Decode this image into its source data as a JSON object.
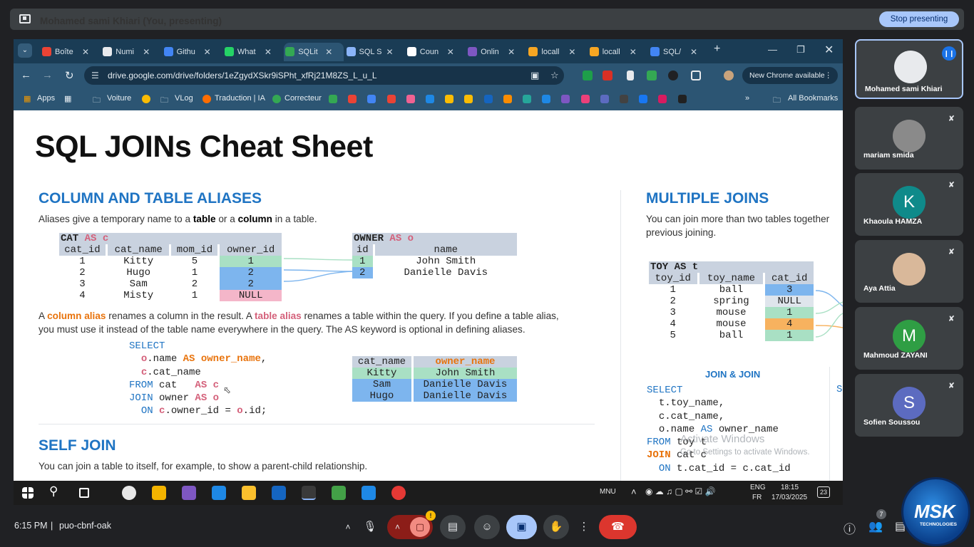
{
  "presenting_bar": {
    "text": "Mohamed sami Khiari (You, presenting)",
    "stop_label": "Stop presenting"
  },
  "browser": {
    "tabs": [
      {
        "label": "Boîte",
        "color": "#ea4335"
      },
      {
        "label": "Numi",
        "color": "#e8eaed"
      },
      {
        "label": "Githu",
        "color": "#4285f4"
      },
      {
        "label": "What",
        "color": "#25d366"
      },
      {
        "label": "SQLit",
        "color": "#34a853"
      },
      {
        "label": "SQL S",
        "color": "#8ab4f8"
      },
      {
        "label": "Coun",
        "color": "#ffffff"
      },
      {
        "label": "Onlin",
        "color": "#7e57c2"
      },
      {
        "label": "locall",
        "color": "#f6a623"
      },
      {
        "label": "locall",
        "color": "#f6a623"
      },
      {
        "label": "SQL/",
        "color": "#4285f4"
      }
    ],
    "url": "drive.google.com/drive/folders/1eZgydXSkr9iSPht_xfRj21M8ZS_L_u_L",
    "new_chrome": "New Chrome available",
    "bookmarks": {
      "apps": "Apps",
      "voiture": "Voiture",
      "vlog": "VLog",
      "traduction": "Traduction | IA",
      "correcteur": "Correcteur",
      "all": "All Bookmarks"
    }
  },
  "doc": {
    "title": "SQL JOINs Cheat Sheet",
    "aliases": {
      "heading": "COLUMN AND TABLE ALIASES",
      "intro": {
        "a": "Aliases give a temporary name to a ",
        "table": "table",
        "b": " or a ",
        "column": "column",
        "c": " in a table."
      },
      "cat_table": {
        "title": "CAT",
        "alias_kw": "AS c",
        "headers": [
          "cat_id",
          "cat_name",
          "mom_id",
          "owner_id"
        ],
        "rows": [
          [
            "1",
            "Kitty",
            "5",
            "1"
          ],
          [
            "2",
            "Hugo",
            "1",
            "2"
          ],
          [
            "3",
            "Sam",
            "2",
            "2"
          ],
          [
            "4",
            "Misty",
            "1",
            "NULL"
          ]
        ]
      },
      "owner_table": {
        "title": "OWNER",
        "alias_kw": "AS o",
        "headers": [
          "id",
          "name"
        ],
        "rows": [
          [
            "1",
            "John Smith"
          ],
          [
            "2",
            "Danielle Davis"
          ]
        ]
      },
      "desc": {
        "a": "A ",
        "column_alias": "column alias",
        "b": " renames a column in the result. A ",
        "table_alias": "table alias",
        "c": " renames a table within the query. If you define a table alias,",
        "line2": "you must use it instead of the table name everywhere in the query. The AS keyword is optional in defining aliases."
      },
      "sql": {
        "select": "SELECT",
        "o": "o",
        "name": ".name ",
        "as": "AS",
        "owner_name": "owner_name",
        "comma": ",",
        "c": "c",
        "cat_name": ".cat_name",
        "from": "FROM",
        "cat": " cat   ",
        "join": "JOIN",
        "owner": " owner ",
        "on": "ON",
        "owner_id": ".owner_id = ",
        "id": ".id;"
      },
      "result": {
        "headers": [
          "cat_name",
          "owner_name"
        ],
        "rows": [
          [
            "Kitty",
            "John Smith"
          ],
          [
            "Sam",
            "Danielle Davis"
          ],
          [
            "Hugo",
            "Danielle Davis"
          ]
        ]
      }
    },
    "self_join": {
      "heading": "SELF JOIN",
      "text": "You can join a table to itself, for example, to show a parent-child relationship."
    },
    "multiple": {
      "heading": "MULTIPLE JOINS",
      "text1": "You can join more than two tables together",
      "text2": "previous joining.",
      "toy_table": {
        "title": "TOY AS t",
        "headers": [
          "toy_id",
          "toy_name",
          "cat_id"
        ],
        "rows": [
          [
            "1",
            "ball",
            "3"
          ],
          [
            "2",
            "spring",
            "NULL"
          ],
          [
            "3",
            "mouse",
            "1"
          ],
          [
            "4",
            "mouse",
            "4"
          ],
          [
            "5",
            "ball",
            "1"
          ]
        ]
      },
      "join_join": "JOIN & JOIN",
      "sql": {
        "select": "SELECT",
        "l1": "t.toy_name,",
        "l2": "c.cat_name,",
        "l3a": "o.name ",
        "as": "AS",
        "l3b": " owner_name",
        "from": "FROM",
        "l4": " toy t",
        "join": "JOIN",
        "l5": " cat c",
        "on": "ON",
        "l6": " t.cat_id = c.cat_id",
        "s": "S"
      },
      "watermark": "Activate Windows",
      "watermark2": "Go to Settings to activate Windows."
    }
  },
  "taskbar": {
    "lang1": "ENG",
    "lang2": "FR",
    "time": "18:15",
    "date": "17/03/2025",
    "mnu": "MNU",
    "notif": "23"
  },
  "participants": [
    {
      "name": "Mohamed sami Khiari"
    },
    {
      "name": "mariam smida"
    },
    {
      "name": "Khaoula HAMZA",
      "initial": "K",
      "color": "#0f8a8a"
    },
    {
      "name": "Aya Attia"
    },
    {
      "name": "Mahmoud ZAYANI",
      "initial": "M",
      "color": "#2f9e44"
    },
    {
      "name": "Sofien Soussou",
      "initial": "S",
      "color": "#5c6bc0"
    }
  ],
  "meet": {
    "time": "6:15 PM",
    "code": "puo-cbnf-oak",
    "people_count": "7",
    "logo": "MSK",
    "logo_sub": "TECHNOLOGIES"
  }
}
